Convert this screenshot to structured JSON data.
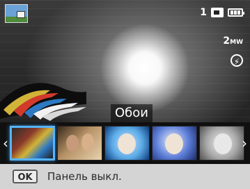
{
  "status": {
    "shots_remaining": "1",
    "memory_icon": "memory-card-icon",
    "battery_icon": "battery-full-icon"
  },
  "badges": {
    "resolution": "2",
    "resolution_unit": "MW",
    "flash_icon": "flash-auto-icon"
  },
  "menu": {
    "title": "Обои"
  },
  "thumbnails": [
    {
      "name": "feather-mural",
      "selected": true
    },
    {
      "name": "couple-photo",
      "selected": false
    },
    {
      "name": "child-blue-frame",
      "selected": false
    },
    {
      "name": "child-fantasy-frame",
      "selected": false
    },
    {
      "name": "child-bw-frame",
      "selected": false
    }
  ],
  "footer": {
    "ok_label": "OK",
    "hint": "Панель выкл."
  },
  "colors": {
    "selection": "#56b4ff",
    "footer_bg": "#d4d4d4"
  }
}
